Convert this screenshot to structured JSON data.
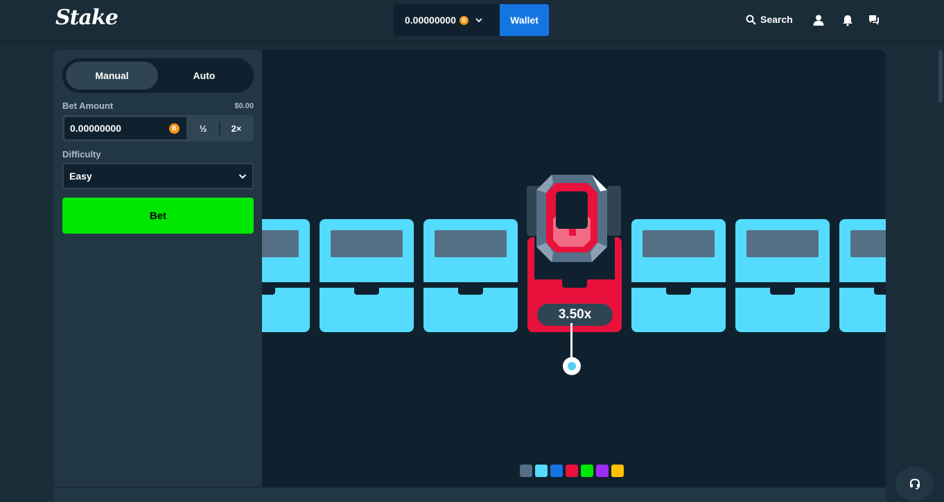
{
  "header": {
    "logo": "Stake",
    "balance": "0.00000000",
    "currency_symbol": "B",
    "wallet_label": "Wallet",
    "search_label": "Search"
  },
  "sidebar": {
    "tabs": [
      {
        "label": "Manual",
        "active": true
      },
      {
        "label": "Auto",
        "active": false
      }
    ],
    "bet_amount_label": "Bet Amount",
    "bet_amount_usd": "$0.00",
    "bet_amount_value": "0.00000000",
    "half_label": "½",
    "double_label": "2×",
    "difficulty_label": "Difficulty",
    "difficulty_value": "Easy",
    "bet_button_label": "Bet"
  },
  "game": {
    "multiplier": "3.50x",
    "tile_color": "#55dbfd",
    "selected_tile_color": "#e9113c",
    "swatches": [
      "#557086",
      "#55dbfd",
      "#1475e1",
      "#e9113c",
      "#00e701",
      "#9d2bf5",
      "#ffc200"
    ]
  }
}
